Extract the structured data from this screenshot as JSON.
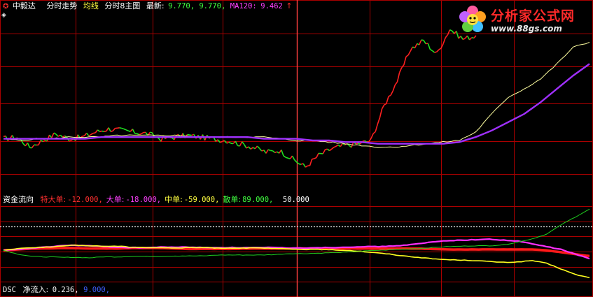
{
  "header": {
    "stock_name": "中毅达",
    "menu": [
      "分时走势",
      "均线",
      "分时8主图"
    ],
    "latest_label": "最新:",
    "latest_values": "9.770, 9.770,",
    "ma_label": "MA120:",
    "ma_value": "9.462",
    "arrow": "↑"
  },
  "flow_header": {
    "title": "资金流向",
    "items": [
      {
        "label": "特大单:",
        "value": "-12.000,",
        "color": "#ff3030"
      },
      {
        "label": "大单:",
        "value": "-18.000,",
        "color": "#ff40ff"
      },
      {
        "label": "中单:",
        "value": "-59.000,",
        "color": "#ffff40"
      },
      {
        "label": "散单:",
        "value": "89.000,",
        "color": "#40ff40"
      }
    ],
    "tail": "50.000"
  },
  "dsc_header": {
    "title": "DSC",
    "net_label": "净流入:",
    "net_value": "0.236,",
    "extra": "9.000,"
  },
  "logo": {
    "name": "分析家公式网",
    "url": "www.88gs.com"
  },
  "colors": {
    "grid": "#aa0000",
    "price_up": "#ff2020",
    "price_down": "#20e020",
    "avg_line": "#ffffa0",
    "ma120": "#a030ff",
    "extra_large": "#ff1a1a",
    "large": "#ff30ff",
    "medium": "#ffff20",
    "small": "#20d020",
    "label_default": "#c8c8c8"
  },
  "chart_data": [
    {
      "type": "line",
      "title": "分时走势",
      "series": [
        {
          "name": "最新",
          "values": [
            9.3,
            9.31,
            9.25,
            9.29,
            9.33,
            9.3,
            9.31,
            9.34,
            9.36,
            9.35,
            9.34,
            9.33,
            9.3,
            9.31,
            9.32,
            9.31,
            9.3,
            9.29,
            9.27,
            9.25,
            9.22,
            9.23,
            9.18,
            9.13,
            9.2,
            9.24,
            9.26,
            9.27,
            9.29,
            9.5,
            9.65,
            9.84,
            9.89,
            9.81,
            9.96,
            9.9,
            9.92
          ]
        },
        {
          "name": "均价",
          "values": [
            9.3,
            9.29,
            9.3,
            9.3,
            9.31,
            9.31,
            9.31,
            9.32,
            9.32,
            9.32,
            9.32,
            9.32,
            9.31,
            9.31,
            9.31,
            9.31,
            9.31,
            9.3,
            9.29,
            9.29,
            9.28,
            9.27,
            9.26,
            9.25,
            9.25,
            9.26,
            9.27,
            9.28,
            9.29,
            9.34,
            9.45,
            9.55,
            9.6,
            9.66,
            9.75,
            9.85,
            9.88
          ]
        },
        {
          "name": "MA120",
          "values": [
            9.3,
            9.3,
            9.3,
            9.3,
            9.3,
            9.3,
            9.31,
            9.31,
            9.31,
            9.31,
            9.31,
            9.31,
            9.31,
            9.31,
            9.31,
            9.31,
            9.3,
            9.3,
            9.3,
            9.29,
            9.29,
            9.28,
            9.28,
            9.27,
            9.27,
            9.27,
            9.27,
            9.27,
            9.28,
            9.31,
            9.35,
            9.4,
            9.45,
            9.52,
            9.6,
            9.68,
            9.75
          ]
        }
      ]
    },
    {
      "type": "line",
      "title": "资金流向",
      "series": [
        {
          "name": "特大单",
          "values": [
            0,
            2,
            4,
            4,
            5,
            5,
            4,
            4,
            4,
            5,
            5,
            5,
            4,
            3,
            3,
            3,
            3,
            4,
            4,
            4,
            4,
            4,
            4,
            4,
            4,
            4,
            4,
            4,
            4,
            4,
            3,
            2,
            2,
            2,
            2,
            2,
            2,
            2,
            0,
            -4,
            -8,
            -12
          ]
        },
        {
          "name": "大单",
          "values": [
            0,
            2,
            5,
            7,
            10,
            11,
            10,
            8,
            7,
            6,
            6,
            7,
            7,
            7,
            6,
            6,
            6,
            6,
            6,
            6,
            5,
            5,
            6,
            6,
            7,
            8,
            8,
            9,
            11,
            14,
            18,
            21,
            22,
            23,
            24,
            22,
            20,
            14,
            8,
            2,
            -8,
            -18
          ]
        },
        {
          "name": "中单",
          "values": [
            0,
            4,
            6,
            7,
            9,
            11,
            10,
            9,
            9,
            7,
            6,
            6,
            5,
            6,
            6,
            5,
            5,
            5,
            5,
            4,
            3,
            2,
            2,
            1,
            0,
            -2,
            -5,
            -8,
            -12,
            -15,
            -18,
            -20,
            -21,
            -22,
            -24,
            -26,
            -25,
            -22,
            -28,
            -40,
            -52,
            -59
          ]
        },
        {
          "name": "散单",
          "values": [
            0,
            -8,
            -13,
            -14,
            -15,
            -15,
            -16,
            -14,
            -14,
            -13,
            -13,
            -13,
            -12,
            -12,
            -12,
            -10,
            -10,
            -10,
            -10,
            -9,
            -7,
            -7,
            -6,
            -5,
            -4,
            -2,
            0,
            1,
            3,
            4,
            6,
            8,
            9,
            10,
            10,
            12,
            18,
            25,
            35,
            55,
            72,
            89
          ]
        }
      ]
    }
  ]
}
